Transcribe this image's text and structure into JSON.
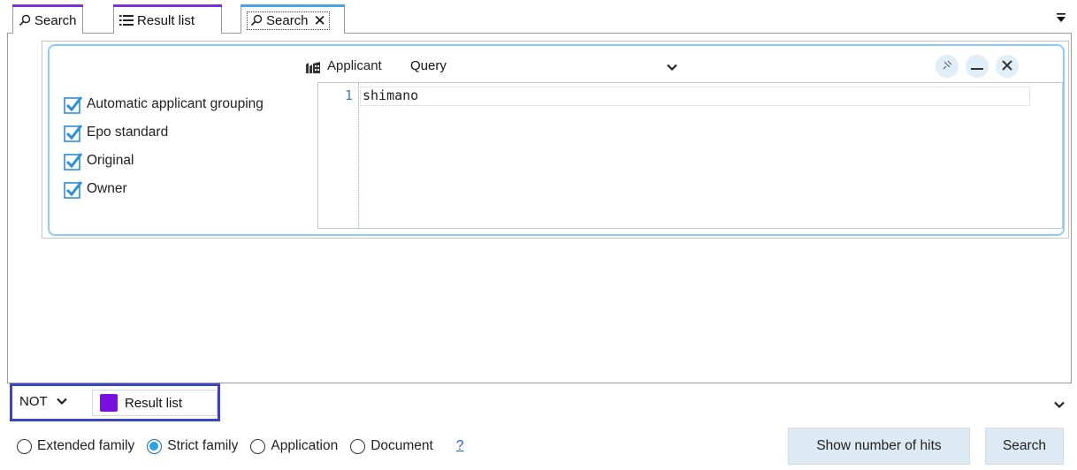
{
  "tabs": [
    {
      "label": "Search",
      "icon": "search-icon"
    },
    {
      "label": "Result list",
      "icon": "list-icon"
    },
    {
      "label": "Search",
      "icon": "search-icon",
      "active": true,
      "close": "✕"
    }
  ],
  "colors": {
    "tab_accent": "#7a2fd9",
    "active_tab_accent": "#4aa3df",
    "block_border": "#8ecbf0",
    "result_swatch": "#7a10e0",
    "filter_highlight": "#3d44c4",
    "radio_selected": "#29a1e8",
    "button_bg": "#dde9f3"
  },
  "query_block": {
    "field_label": "Applicant",
    "field_icon": "building-icon",
    "query_type": "Query",
    "header_buttons": [
      "pin-icon",
      "minimize-icon",
      "close-icon"
    ],
    "options": [
      {
        "label": "Automatic applicant grouping",
        "checked": true
      },
      {
        "label": "Epo standard",
        "checked": true
      },
      {
        "label": "Original",
        "checked": true
      },
      {
        "label": "Owner",
        "checked": true
      }
    ],
    "editor": {
      "line_number": "1",
      "text": "shimano"
    }
  },
  "filter": {
    "operator": "NOT",
    "result_label": "Result list"
  },
  "family_options": [
    {
      "label": "Extended family",
      "selected": false
    },
    {
      "label": "Strict family",
      "selected": true
    },
    {
      "label": "Application",
      "selected": false
    },
    {
      "label": "Document",
      "selected": false
    }
  ],
  "help_label": "?",
  "buttons": {
    "hits_label": "Show number of hits",
    "search_label": "Search"
  }
}
